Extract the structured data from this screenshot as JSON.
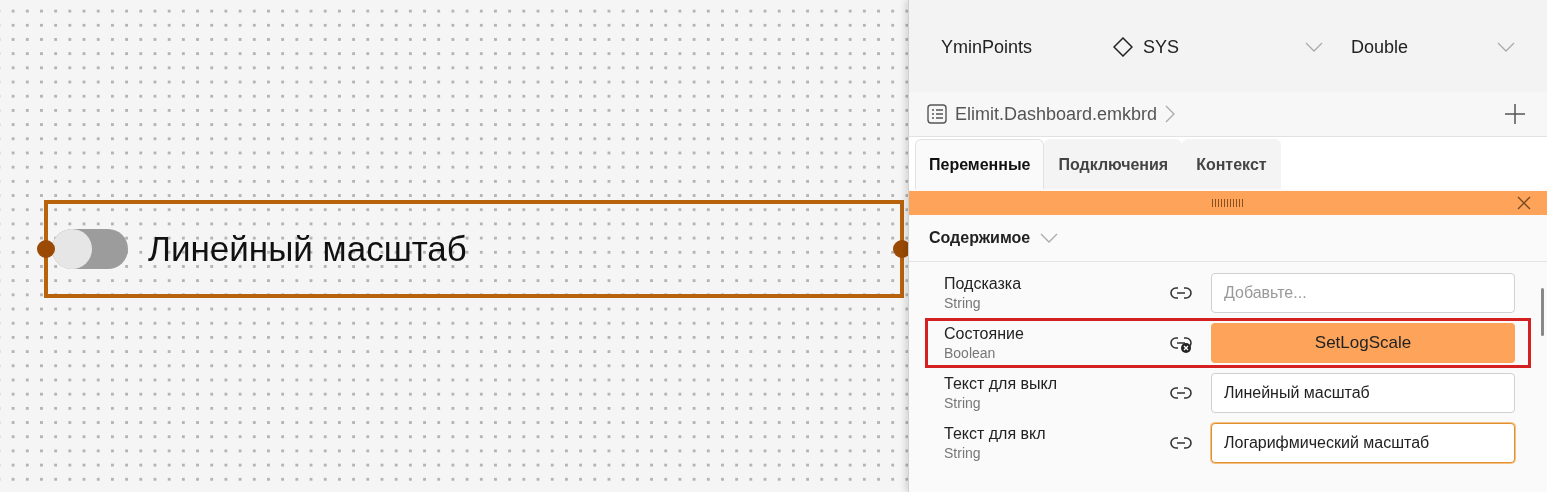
{
  "canvas": {
    "toggle_widget": {
      "label": "Линейный масштаб",
      "on": false,
      "selected": true
    }
  },
  "panel": {
    "variables": [
      {
        "name": "YminPoints",
        "scope": "SYS",
        "type": "Double"
      }
    ],
    "breadcrumb": {
      "file": "Elimit.Dashboard.emkbrd"
    },
    "tabs": [
      {
        "label": "Переменные",
        "selected": true
      },
      {
        "label": "Подключения",
        "selected": false
      },
      {
        "label": "Контекст",
        "selected": false
      }
    ],
    "section": {
      "title": "Содержимое",
      "expanded": true
    },
    "properties": [
      {
        "name": "Подсказка",
        "type": "String",
        "kind": "text",
        "placeholder": "Добавьте...",
        "bound": false,
        "highlighted": false,
        "focused": false
      },
      {
        "name": "Состояние",
        "type": "Boolean",
        "kind": "binding",
        "value": "SetLogScale",
        "bound": true,
        "highlighted": true
      },
      {
        "name": "Текст для выкл",
        "type": "String",
        "kind": "text",
        "value": "Линейный масштаб",
        "bound": false,
        "highlighted": false,
        "focused": false
      },
      {
        "name": "Текст для вкл",
        "type": "String",
        "kind": "text",
        "value": "Логарифмический масштаб",
        "bound": false,
        "highlighted": false,
        "focused": true
      }
    ]
  }
}
